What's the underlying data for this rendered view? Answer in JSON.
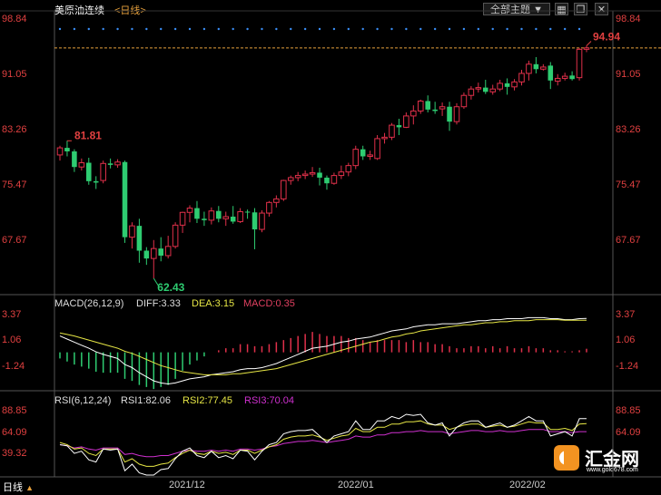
{
  "header": {
    "title": "美原油连续",
    "period": "<日线>",
    "theme_button": "全部主题",
    "theme_arrow": "▼",
    "window_icons": [
      "grid-icon",
      "restore-icon",
      "close-icon"
    ]
  },
  "price_axis": {
    "labels": [
      "98.84",
      "91.05",
      "83.26",
      "75.47",
      "67.67"
    ]
  },
  "price_annotations": {
    "high": "81.81",
    "low": "62.43",
    "last": "94.94"
  },
  "macd": {
    "label": "MACD(26,12,9)",
    "diff": "DIFF:3.33",
    "dea": "DEA:3.15",
    "macd": "MACD:0.35",
    "axis": [
      "3.37",
      "1.06",
      "-1.24"
    ]
  },
  "rsi": {
    "label": "RSI(6,12,24)",
    "rsi1": "RSI1:82.06",
    "rsi2": "RSI2:77.45",
    "rsi3": "RSI3:70.04",
    "axis": [
      "88.85",
      "64.09",
      "39.32"
    ]
  },
  "footer": {
    "period": "日线",
    "period_arrow": "▲",
    "dates": [
      "2021/12",
      "2022/01",
      "2022/02"
    ]
  },
  "watermark": {
    "brand": "汇金网",
    "url": "www.gold678.com"
  },
  "colors": {
    "up": "#e0304a",
    "down": "#2ecc71",
    "axis_red": "#e04040",
    "diff_line": "#ffffff",
    "dea_line": "#e6e645",
    "rsi3_line": "#d030d0"
  },
  "chart_data": {
    "type": "candlestick",
    "price_ylim": [
      62.4,
      98.84
    ],
    "candles": [
      {
        "o": 79.8,
        "c": 80.8,
        "h": 81.1,
        "l": 79.0
      },
      {
        "o": 80.8,
        "c": 80.3,
        "h": 81.8,
        "l": 79.6
      },
      {
        "o": 80.3,
        "c": 78.1,
        "h": 80.6,
        "l": 77.4
      },
      {
        "o": 78.1,
        "c": 78.7,
        "h": 79.3,
        "l": 77.6
      },
      {
        "o": 78.7,
        "c": 76.1,
        "h": 79.4,
        "l": 75.6
      },
      {
        "o": 76.1,
        "c": 75.9,
        "h": 76.8,
        "l": 75.0
      },
      {
        "o": 76.2,
        "c": 78.6,
        "h": 79.0,
        "l": 75.8
      },
      {
        "o": 78.6,
        "c": 78.4,
        "h": 79.3,
        "l": 77.9
      },
      {
        "o": 78.4,
        "c": 78.8,
        "h": 79.2,
        "l": 78.0
      },
      {
        "o": 78.8,
        "c": 68.2,
        "h": 79.0,
        "l": 67.4
      },
      {
        "o": 68.2,
        "c": 69.8,
        "h": 70.3,
        "l": 66.6
      },
      {
        "o": 69.8,
        "c": 66.3,
        "h": 70.8,
        "l": 64.6
      },
      {
        "o": 66.3,
        "c": 65.2,
        "h": 66.8,
        "l": 64.3
      },
      {
        "o": 65.2,
        "c": 66.6,
        "h": 67.8,
        "l": 62.4
      },
      {
        "o": 66.6,
        "c": 65.6,
        "h": 68.2,
        "l": 64.8
      },
      {
        "o": 65.6,
        "c": 66.9,
        "h": 68.4,
        "l": 65.2
      },
      {
        "o": 66.9,
        "c": 69.9,
        "h": 70.3,
        "l": 66.6
      },
      {
        "o": 69.9,
        "c": 71.7,
        "h": 71.8,
        "l": 68.8
      },
      {
        "o": 71.7,
        "c": 72.3,
        "h": 72.7,
        "l": 70.3
      },
      {
        "o": 72.3,
        "c": 70.8,
        "h": 73.3,
        "l": 70.2
      },
      {
        "o": 70.8,
        "c": 70.6,
        "h": 71.8,
        "l": 69.8
      },
      {
        "o": 70.6,
        "c": 71.9,
        "h": 72.4,
        "l": 70.0
      },
      {
        "o": 71.9,
        "c": 70.8,
        "h": 72.6,
        "l": 70.3
      },
      {
        "o": 70.8,
        "c": 71.1,
        "h": 71.8,
        "l": 69.8
      },
      {
        "o": 71.1,
        "c": 70.4,
        "h": 72.6,
        "l": 70.1
      },
      {
        "o": 70.4,
        "c": 71.8,
        "h": 72.3,
        "l": 70.2
      },
      {
        "o": 71.8,
        "c": 71.7,
        "h": 72.1,
        "l": 70.8
      },
      {
        "o": 71.7,
        "c": 69.3,
        "h": 72.3,
        "l": 66.5
      },
      {
        "o": 69.3,
        "c": 71.6,
        "h": 72.0,
        "l": 68.9
      },
      {
        "o": 71.6,
        "c": 73.1,
        "h": 73.3,
        "l": 71.1
      },
      {
        "o": 73.1,
        "c": 73.6,
        "h": 74.1,
        "l": 72.4
      },
      {
        "o": 73.6,
        "c": 76.2,
        "h": 76.3,
        "l": 73.3
      },
      {
        "o": 76.2,
        "c": 76.6,
        "h": 76.9,
        "l": 75.6
      },
      {
        "o": 76.6,
        "c": 76.9,
        "h": 77.4,
        "l": 76.1
      },
      {
        "o": 76.9,
        "c": 77.1,
        "h": 77.6,
        "l": 76.4
      },
      {
        "o": 77.1,
        "c": 77.3,
        "h": 78.1,
        "l": 76.7
      },
      {
        "o": 77.3,
        "c": 76.6,
        "h": 78.0,
        "l": 75.5
      },
      {
        "o": 76.6,
        "c": 75.8,
        "h": 76.9,
        "l": 74.9
      },
      {
        "o": 75.8,
        "c": 76.9,
        "h": 77.3,
        "l": 75.6
      },
      {
        "o": 76.9,
        "c": 77.4,
        "h": 78.3,
        "l": 76.4
      },
      {
        "o": 77.4,
        "c": 78.3,
        "h": 78.7,
        "l": 76.8
      },
      {
        "o": 78.3,
        "c": 80.6,
        "h": 81.1,
        "l": 77.8
      },
      {
        "o": 80.6,
        "c": 79.6,
        "h": 81.1,
        "l": 79.1
      },
      {
        "o": 79.6,
        "c": 79.8,
        "h": 80.4,
        "l": 79.1
      },
      {
        "o": 79.3,
        "c": 82.1,
        "h": 82.6,
        "l": 79.1
      },
      {
        "o": 82.1,
        "c": 82.3,
        "h": 82.9,
        "l": 81.4
      },
      {
        "o": 82.3,
        "c": 84.0,
        "h": 84.3,
        "l": 81.9
      },
      {
        "o": 84.0,
        "c": 83.7,
        "h": 84.9,
        "l": 82.6
      },
      {
        "o": 83.7,
        "c": 85.3,
        "h": 85.8,
        "l": 83.6
      },
      {
        "o": 85.3,
        "c": 86.0,
        "h": 86.8,
        "l": 84.1
      },
      {
        "o": 86.0,
        "c": 87.4,
        "h": 87.6,
        "l": 85.6
      },
      {
        "o": 87.4,
        "c": 86.2,
        "h": 88.2,
        "l": 85.8
      },
      {
        "o": 86.2,
        "c": 86.0,
        "h": 87.3,
        "l": 85.6
      },
      {
        "o": 86.3,
        "c": 86.6,
        "h": 87.2,
        "l": 85.3
      },
      {
        "o": 86.6,
        "c": 84.5,
        "h": 87.3,
        "l": 83.2
      },
      {
        "o": 84.5,
        "c": 86.6,
        "h": 87.1,
        "l": 84.1
      },
      {
        "o": 86.6,
        "c": 88.2,
        "h": 88.6,
        "l": 86.3
      },
      {
        "o": 88.2,
        "c": 89.1,
        "h": 89.5,
        "l": 87.6
      },
      {
        "o": 89.1,
        "c": 89.3,
        "h": 90.0,
        "l": 88.6
      },
      {
        "o": 89.3,
        "c": 88.7,
        "h": 90.4,
        "l": 88.4
      },
      {
        "o": 88.7,
        "c": 89.1,
        "h": 89.7,
        "l": 88.3
      },
      {
        "o": 89.1,
        "c": 89.9,
        "h": 90.4,
        "l": 88.8
      },
      {
        "o": 89.9,
        "c": 89.4,
        "h": 90.6,
        "l": 88.3
      },
      {
        "o": 89.4,
        "c": 90.1,
        "h": 90.5,
        "l": 88.9
      },
      {
        "o": 90.1,
        "c": 91.3,
        "h": 91.8,
        "l": 89.6
      },
      {
        "o": 91.3,
        "c": 92.6,
        "h": 93.1,
        "l": 90.3
      },
      {
        "o": 92.6,
        "c": 91.9,
        "h": 93.6,
        "l": 91.3
      },
      {
        "o": 91.9,
        "c": 92.2,
        "h": 92.6,
        "l": 91.7
      },
      {
        "o": 92.4,
        "c": 90.3,
        "h": 92.9,
        "l": 89.1
      },
      {
        "o": 90.2,
        "c": 90.6,
        "h": 91.2,
        "l": 89.6
      },
      {
        "o": 90.6,
        "c": 90.9,
        "h": 91.4,
        "l": 90.3
      },
      {
        "o": 91.0,
        "c": 90.5,
        "h": 91.6,
        "l": 90.3
      },
      {
        "o": 90.7,
        "c": 94.7,
        "h": 94.9,
        "l": 90.3
      },
      {
        "o": 94.7,
        "c": 94.9,
        "h": 95.2,
        "l": 94.3
      }
    ],
    "macd_ylim": [
      -3.5,
      4.5
    ],
    "diff": [
      1.6,
      1.3,
      1.0,
      0.7,
      0.4,
      0.05,
      -0.2,
      -0.4,
      -0.6,
      -1.2,
      -1.5,
      -2.0,
      -2.4,
      -2.8,
      -3.0,
      -3.1,
      -3.0,
      -2.8,
      -2.6,
      -2.5,
      -2.4,
      -2.2,
      -2.1,
      -2.0,
      -1.9,
      -1.7,
      -1.6,
      -1.6,
      -1.5,
      -1.3,
      -1.1,
      -0.8,
      -0.5,
      -0.2,
      0.1,
      0.4,
      0.5,
      0.6,
      0.8,
      1.0,
      1.1,
      1.3,
      1.4,
      1.5,
      1.7,
      1.9,
      2.1,
      2.2,
      2.3,
      2.5,
      2.6,
      2.7,
      2.7,
      2.8,
      2.8,
      2.8,
      2.9,
      3.0,
      3.1,
      3.1,
      3.2,
      3.2,
      3.3,
      3.3,
      3.3,
      3.4,
      3.4,
      3.4,
      3.3,
      3.3,
      3.2,
      3.2,
      3.3,
      3.33
    ],
    "dea": [
      1.9,
      1.75,
      1.6,
      1.4,
      1.2,
      1.0,
      0.8,
      0.6,
      0.4,
      0.1,
      -0.1,
      -0.4,
      -0.7,
      -1.0,
      -1.3,
      -1.5,
      -1.7,
      -1.9,
      -2.0,
      -2.1,
      -2.2,
      -2.2,
      -2.2,
      -2.2,
      -2.1,
      -2.1,
      -2.0,
      -1.9,
      -1.8,
      -1.7,
      -1.6,
      -1.4,
      -1.2,
      -1.0,
      -0.8,
      -0.6,
      -0.4,
      -0.2,
      0.0,
      0.2,
      0.4,
      0.6,
      0.8,
      1.0,
      1.1,
      1.3,
      1.5,
      1.6,
      1.8,
      1.9,
      2.1,
      2.2,
      2.3,
      2.4,
      2.5,
      2.6,
      2.7,
      2.7,
      2.8,
      2.9,
      2.9,
      3.0,
      3.0,
      3.1,
      3.1,
      3.1,
      3.2,
      3.2,
      3.2,
      3.2,
      3.15,
      3.15,
      3.15,
      3.15
    ],
    "macd_hist": [
      -0.6,
      -0.9,
      -1.2,
      -1.4,
      -1.6,
      -1.9,
      -2.0,
      -2.0,
      -2.0,
      -2.6,
      -2.8,
      -3.2,
      -3.4,
      -3.6,
      -3.4,
      -3.2,
      -2.6,
      -1.8,
      -1.2,
      -0.8,
      -0.4,
      0.0,
      0.2,
      0.4,
      0.4,
      0.8,
      0.8,
      0.6,
      0.6,
      0.8,
      1.0,
      1.2,
      1.4,
      1.6,
      1.8,
      2.0,
      1.8,
      1.6,
      1.6,
      1.6,
      1.4,
      1.4,
      1.2,
      1.0,
      1.2,
      1.2,
      1.2,
      1.2,
      1.0,
      1.2,
      1.0,
      1.0,
      0.8,
      0.8,
      0.6,
      0.4,
      0.4,
      0.6,
      0.6,
      0.4,
      0.6,
      0.4,
      0.6,
      0.4,
      0.4,
      0.6,
      0.4,
      0.4,
      0.2,
      0.2,
      0.1,
      0.1,
      0.2,
      0.35
    ],
    "rsi_ylim": [
      30,
      96
    ],
    "rsi1": [
      58,
      57,
      50,
      52,
      44,
      42,
      54,
      53,
      54,
      34,
      40,
      32,
      30,
      30,
      35,
      36,
      45,
      52,
      55,
      48,
      46,
      52,
      46,
      48,
      45,
      53,
      52,
      44,
      52,
      58,
      60,
      68,
      70,
      71,
      71,
      72,
      66,
      60,
      66,
      68,
      70,
      80,
      72,
      72,
      80,
      80,
      84,
      82,
      86,
      85,
      86,
      78,
      76,
      78,
      66,
      74,
      78,
      80,
      80,
      74,
      76,
      78,
      74,
      76,
      80,
      84,
      80,
      80,
      66,
      68,
      70,
      66,
      82,
      82
    ],
    "rsi2": [
      60,
      58,
      54,
      55,
      50,
      48,
      54,
      54,
      54,
      42,
      45,
      40,
      38,
      38,
      40,
      41,
      46,
      50,
      53,
      50,
      49,
      52,
      50,
      51,
      49,
      53,
      53,
      50,
      53,
      56,
      58,
      63,
      65,
      66,
      66,
      67,
      65,
      62,
      64,
      66,
      67,
      73,
      70,
      70,
      74,
      74,
      77,
      77,
      79,
      79,
      80,
      77,
      76,
      76,
      72,
      74,
      76,
      77,
      77,
      74,
      75,
      76,
      74,
      75,
      77,
      79,
      78,
      78,
      72,
      72,
      73,
      71,
      77,
      77.45
    ],
    "rsi3": [
      58,
      57,
      55,
      56,
      54,
      53,
      55,
      55,
      55,
      49,
      50,
      48,
      47,
      47,
      48,
      48,
      50,
      52,
      53,
      52,
      52,
      53,
      52,
      53,
      52,
      54,
      54,
      53,
      54,
      56,
      57,
      59,
      60,
      61,
      61,
      62,
      61,
      60,
      61,
      62,
      63,
      66,
      65,
      65,
      67,
      67,
      69,
      69,
      70,
      70,
      71,
      70,
      70,
      70,
      68,
      69,
      70,
      71,
      71,
      70,
      70,
      71,
      70,
      70,
      71,
      72,
      72,
      72,
      70,
      70,
      70,
      69,
      70,
      70.04
    ]
  }
}
